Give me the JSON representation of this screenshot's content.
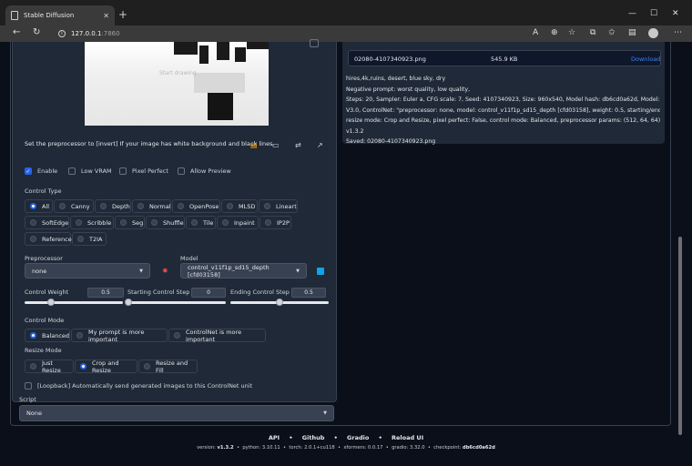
{
  "browser": {
    "tab_title": "Stable Diffusion",
    "tab_close": "✕",
    "new_tab": "+",
    "url_host": "127.0.0.1",
    "url_port": ":7860",
    "window": {
      "min": "—",
      "max": "☐",
      "close": "✕"
    }
  },
  "canvas": {
    "placeholder": "Start drawing"
  },
  "controlnet": {
    "hint": "Set the preprocessor to [invert] If your image has white background and black lines.",
    "checkboxes": [
      {
        "label": "Enable",
        "checked": true
      },
      {
        "label": "Low VRAM",
        "checked": false
      },
      {
        "label": "Pixel Perfect",
        "checked": false
      },
      {
        "label": "Allow Preview",
        "checked": false
      }
    ],
    "control_type_label": "Control Type",
    "control_types_row1": [
      "All",
      "Canny",
      "Depth",
      "Normal",
      "OpenPose",
      "MLSD",
      "Lineart"
    ],
    "control_types_row2": [
      "SoftEdge",
      "Scribble",
      "Seg",
      "Shuffle",
      "Tile",
      "Inpaint",
      "IP2P"
    ],
    "control_types_row3": [
      "Reference",
      "T2IA"
    ],
    "selected_type": "All",
    "preprocessor_label": "Preprocessor",
    "preprocessor_value": "none",
    "model_label": "Model",
    "model_value": "control_v11f1p_sd15_depth [cfd03158]",
    "weight_label": "Control Weight",
    "weight_value": "0.5",
    "start_label": "Starting Control Step",
    "start_value": "0",
    "end_label": "Ending Control Step",
    "end_value": "0.5",
    "mode_label": "Control Mode",
    "modes": [
      "Balanced",
      "My prompt is more important",
      "ControlNet is more important"
    ],
    "selected_mode": "Balanced",
    "resize_label": "Resize Mode",
    "resize_modes": [
      "Just Resize",
      "Crop and Resize",
      "Resize and Fill"
    ],
    "selected_resize": "Crop and Resize",
    "loopback_label": "[Loopback] Automatically send generated images to this ControlNet unit"
  },
  "script": {
    "label": "Script",
    "value": "None"
  },
  "output": {
    "file_name": "02080-4107340923.png",
    "file_size": "545.9 KB",
    "download": "Download",
    "info_lines": [
      "hires,4k,ruins, desert, blue sky, dry",
      "Negative prompt: worst quality, low quality,",
      "Steps: 20, Sampler: Euler a, CFG scale: 7, Seed: 4107340923, Size: 960x540, Model hash: db6cd0a62d, Model: Counterfeit-",
      "V3.0, ControlNet: \"preprocessor: none, model: control_v11f1p_sd15_depth [cfd03158], weight: 0.5, starting/ending: (0, 1),",
      "resize mode: Crop and Resize, pixel perfect: False, control mode: Balanced, preprocessor params: (512, 64, 64)\", Version:",
      "v1.3.2",
      "Saved: 02080-4107340923.png"
    ]
  },
  "footer": {
    "links": [
      "API",
      "Github",
      "Gradio",
      "Reload UI"
    ],
    "sep": "•",
    "version": "version: ",
    "version_v": "v1.3.2",
    "python": "python: 3.10.11",
    "torch": "torch: 2.0.1+cu118",
    "xformers": "xformers: 0.0.17",
    "gradio": "gradio: 3.32.0",
    "checkpoint": "checkpoint: ",
    "checkpoint_v": "db6cd0a62d"
  },
  "colors": {
    "accent": "#2563eb",
    "panel": "#1f2937",
    "bg": "#0b0f19",
    "download": "#3b82f6"
  }
}
